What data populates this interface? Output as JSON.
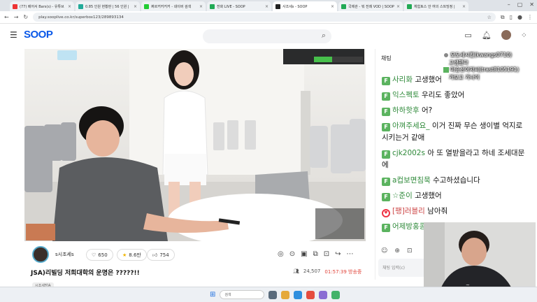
{
  "browser": {
    "tabs": [
      {
        "label": "(77) 베어서 Bars(s) - 유튜브",
        "color": "#e33",
        "active": false
      },
      {
        "label": "0.85 인원 현황판 | 56 인원 |",
        "color": "#2a9",
        "active": false
      },
      {
        "label": "쩌르커커커커 - 네이버 검색",
        "color": "#2c3",
        "active": false
      },
      {
        "label": "전화 LIVE - SOOP",
        "color": "#2a5",
        "active": false
      },
      {
        "label": "사조세s - SOOP",
        "color": "#222",
        "active": true
      },
      {
        "label": "국제관 - 뭐 전례 VOD | SOOP",
        "color": "#2a5",
        "active": false
      },
      {
        "label": "체험토스 안 여의 스트밍정 |",
        "color": "#2a5",
        "active": false
      }
    ],
    "url": "play.sooplive.co.kr/superbox123/289893134"
  },
  "header": {
    "logo": "SOOP"
  },
  "stream": {
    "channel_name": "s시조세s",
    "likes": "650",
    "stars": "8.6만",
    "thumbs": "754",
    "title": "JSA)리빌딩 저희대학의 운명은 ?????!!",
    "viewers": "24,507",
    "live_time": "01:57:39 방송중",
    "tag": "시조세방송",
    "progress_fill": 0.37
  },
  "chat": {
    "header": "채팅",
    "messages": [
      {
        "badge": "F",
        "nick": "사리화",
        "text": "고생했어"
      },
      {
        "badge": "F",
        "nick": "익스펙토",
        "text": "우리도 좋았어"
      },
      {
        "badge": "F",
        "nick": "하하핫후",
        "text": "어?"
      },
      {
        "badge": "F",
        "nick": "아껴주세요_",
        "text": "이거 진짜 무슨 생이별 억지로 시키는거 같애"
      },
      {
        "badge": "F",
        "nick": "cjk2002s",
        "text": "아 또 열받을라고 하네 조세대문에"
      },
      {
        "badge": "F",
        "nick": "a컵보면침묵",
        "text": "수고하셨습니다"
      },
      {
        "badge": "F",
        "nick": "☆준이",
        "text": "고생했어"
      },
      {
        "badge": "heart",
        "nick": "[팽]러블리",
        "text": "남아줘"
      },
      {
        "badge": "F",
        "nick": "어제방홍콩감",
        "text": "ㅜㅜ"
      }
    ],
    "input_placeholder": "채팅 입력(c)"
  },
  "overlay_chat": [
    {
      "name": "모도세시킨(kwangs0710)",
      "text": "고생했다"
    },
    {
      "name": "마승선아저씨(trast8105191)",
      "text": "가보고 가나이"
    }
  ],
  "taskbar": {
    "search_placeholder": "검색"
  }
}
